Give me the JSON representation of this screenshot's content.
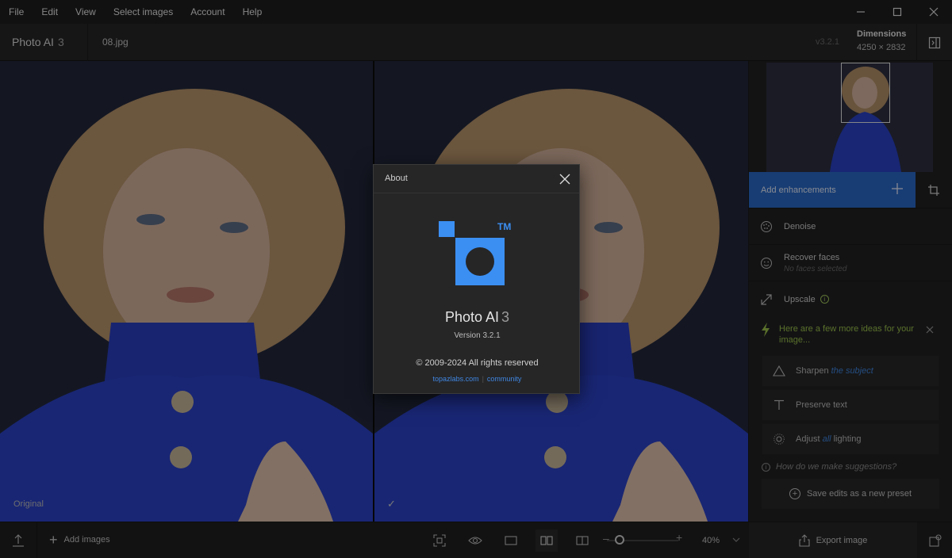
{
  "menu": {
    "items": [
      "File",
      "Edit",
      "View",
      "Select images",
      "Account",
      "Help"
    ]
  },
  "titlebar": {
    "app_name": "Photo AI",
    "app_version": "3",
    "file_name": "08.jpg",
    "version": "v3.2.1",
    "dimensions_label": "Dimensions",
    "dimensions_value": "4250 × 2832"
  },
  "viewport": {
    "left_label": "Original",
    "right_label": "✓"
  },
  "panel": {
    "add_enhancements": "Add enhancements",
    "enhancements": [
      {
        "label": "Denoise",
        "sub": ""
      },
      {
        "label": "Recover faces",
        "sub": "No faces selected"
      },
      {
        "label": "Upscale",
        "sub": ""
      }
    ],
    "ideas_text": "Here are a few more ideas for your image...",
    "suggestions": [
      {
        "pre": "Sharpen",
        "em": "the subject",
        "post": ""
      },
      {
        "pre": "Preserve text",
        "em": "",
        "post": ""
      },
      {
        "pre": "Adjust",
        "em": "all",
        "post": "lighting"
      }
    ],
    "how_text": "How do we make suggestions?",
    "save_preset": "Save edits as a new preset"
  },
  "bottombar": {
    "add_images": "Add images",
    "zoom": "40%",
    "export": "Export image"
  },
  "about": {
    "title": "About",
    "app_name": "Photo AI",
    "app_version": "3",
    "tm": "TM",
    "version": "Version 3.2.1",
    "copyright": "© 2009-2024 All rights reserved",
    "link_site": "topazlabs.com",
    "link_sep": "|",
    "link_community": "community"
  },
  "colors": {
    "accent": "#2a69c8",
    "logo_blue": "#3b8ff2",
    "ideas_green": "#9bc24a"
  }
}
